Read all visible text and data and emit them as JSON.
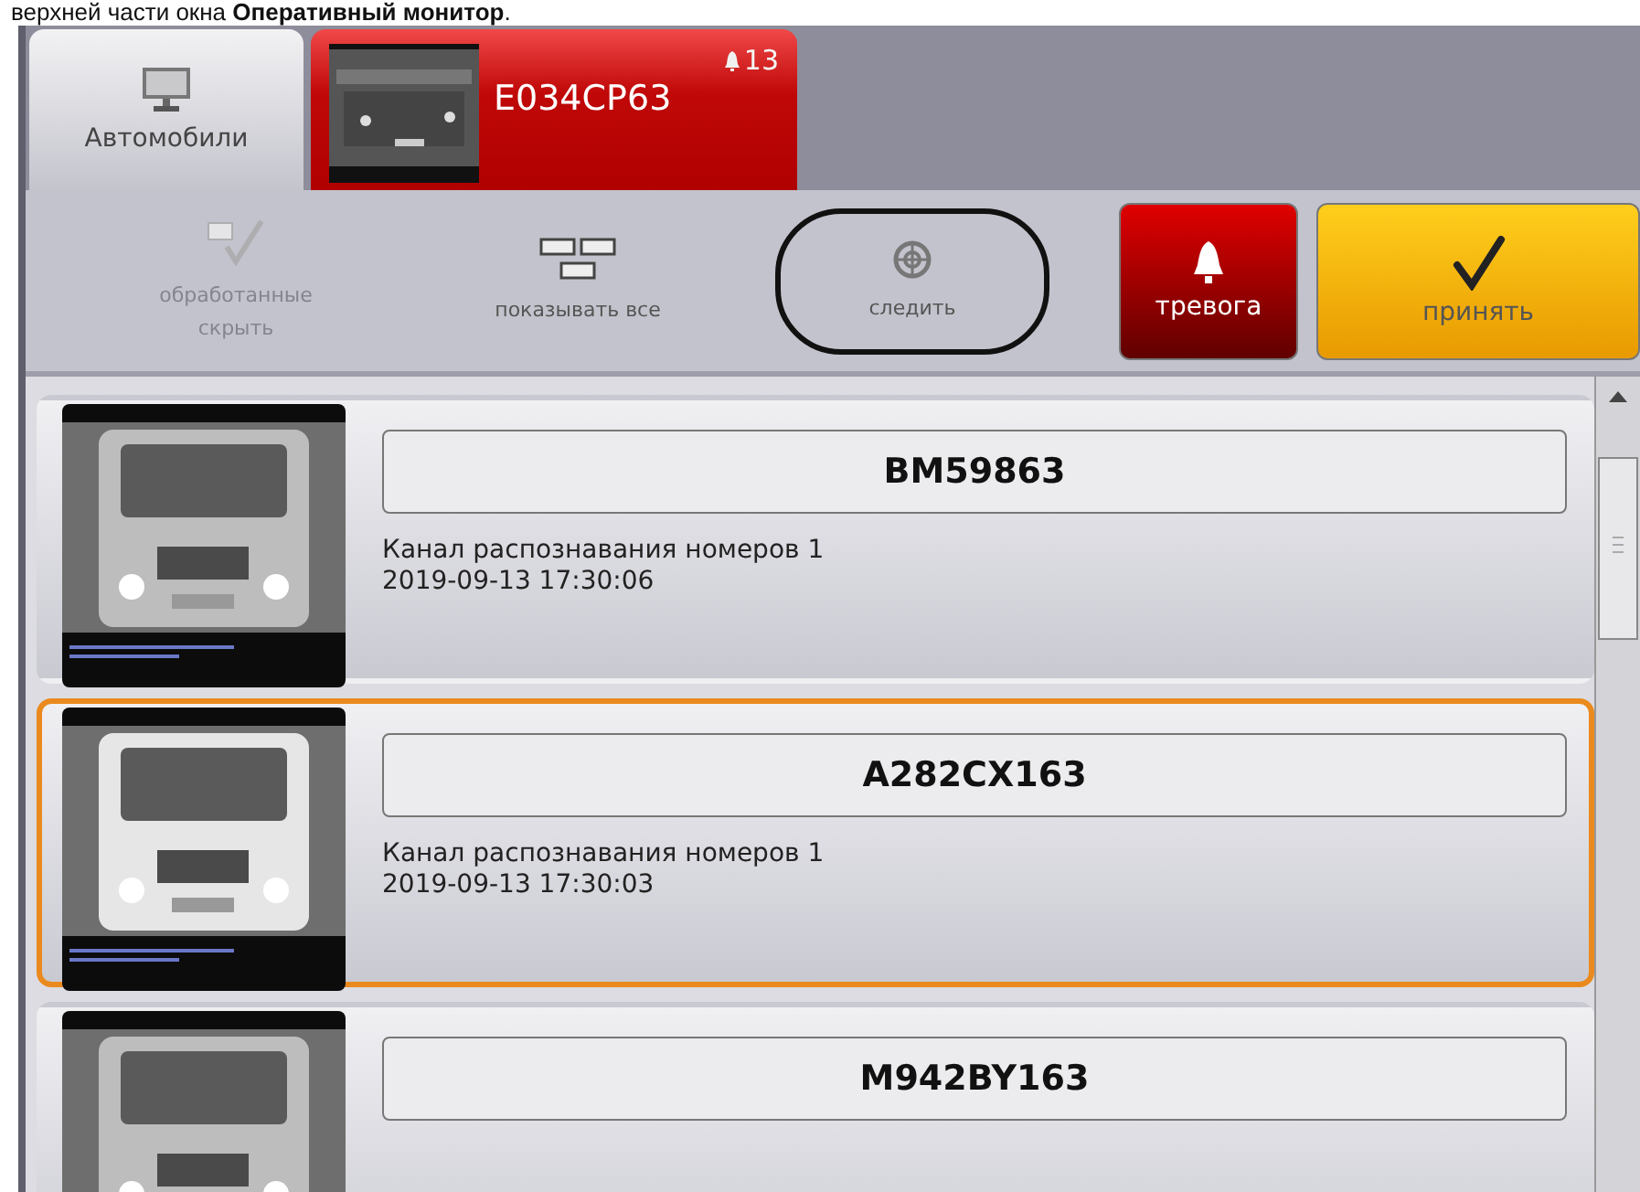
{
  "caption": "верхней части окна **Оперативный монитор**.",
  "tabs": [
    {
      "kind": "category",
      "label": "Автомобили",
      "selected": true,
      "alarm": false
    },
    {
      "kind": "event",
      "plate": "E034CP63",
      "count": "13",
      "selected": false,
      "alarm": true
    }
  ],
  "toolbar": [
    {
      "kind": "hide",
      "label": "обработанные скрыть",
      "disabled": true,
      "circled": false
    },
    {
      "kind": "show-all",
      "label": "показывать все",
      "disabled": false,
      "circled": false
    },
    {
      "kind": "track",
      "label": "следить",
      "disabled": false,
      "circled": true
    },
    {
      "kind": "alarm",
      "label": "тревога",
      "disabled": false,
      "circled": false
    },
    {
      "kind": "accept",
      "label": "принять",
      "disabled": false,
      "circled": false
    }
  ],
  "events": [
    {
      "plate": "BM59863",
      "channel": "Канал распознавания номеров 1",
      "time": "2019-09-13 17:30:06",
      "selected": false
    },
    {
      "plate": "A282CX163",
      "channel": "Канал распознавания номеров 1",
      "time": "2019-09-13 17:30:03",
      "selected": true
    },
    {
      "plate": "M942BY163",
      "selected": false
    }
  ]
}
